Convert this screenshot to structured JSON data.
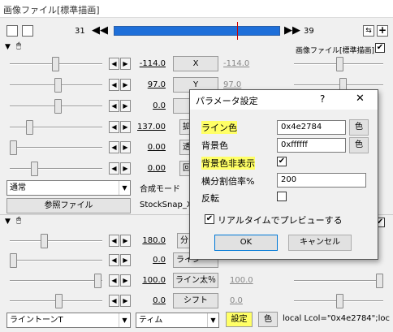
{
  "window": {
    "title": "画像ファイル[標準描画]"
  },
  "timeline": {
    "start_frame": "31",
    "end_frame": "39"
  },
  "object_header": {
    "label": "画像ファイル[標準描画]",
    "checked": true
  },
  "params": [
    {
      "value": "-114.0",
      "button": "X",
      "end_value": "-114.0"
    },
    {
      "value": "97.0",
      "button": "Y",
      "end_value": "97.0"
    },
    {
      "value": "0.0",
      "button": "",
      "end_value": ""
    },
    {
      "value": "137.00",
      "button": "拡",
      "end_value": ""
    },
    {
      "value": "0.00",
      "button": "透",
      "end_value": ""
    },
    {
      "value": "0.00",
      "button": "回",
      "end_value": ""
    }
  ],
  "blend": {
    "mode": "通常",
    "label": "合成モード"
  },
  "ref_file": {
    "button": "参照ファイル",
    "filename": "StockSnap_X"
  },
  "filter_params": [
    {
      "value": "180.0",
      "button": "分",
      "end_value": ""
    },
    {
      "value": "0.0",
      "button": "ライン",
      "end_value": ""
    },
    {
      "value": "100.0",
      "button": "ライン太％",
      "end_value": "100.0"
    },
    {
      "value": "0.0",
      "button": "シフト",
      "end_value": "0.0"
    }
  ],
  "footer": {
    "effect_select": "ライントーンT",
    "mode_select": "ティム",
    "settings_button": "設定",
    "color_button": "色",
    "script_text": "local Lcol=\"0x4e2784\";loc"
  },
  "dialog": {
    "title": "パラメータ設定",
    "help": "?",
    "close": "✕",
    "line_color_label": "ライン色",
    "line_color_value": "0x4e2784",
    "line_color_btn": "色",
    "bg_color_label": "背景色",
    "bg_color_value": "0xffffff",
    "bg_color_btn": "色",
    "bg_hide_label": "背景色非表示",
    "bg_hide_checked": true,
    "div_label": "横分割倍率%",
    "div_value": "200",
    "flip_label": "反転",
    "flip_checked": false,
    "realtime_label": "リアルタイムでプレビューする",
    "realtime_checked": true,
    "ok": "OK",
    "cancel": "キャンセル"
  },
  "colors": {
    "timeline": "#1e6fd9",
    "highlight": "#ffff66",
    "cursor": "#cc0000"
  }
}
